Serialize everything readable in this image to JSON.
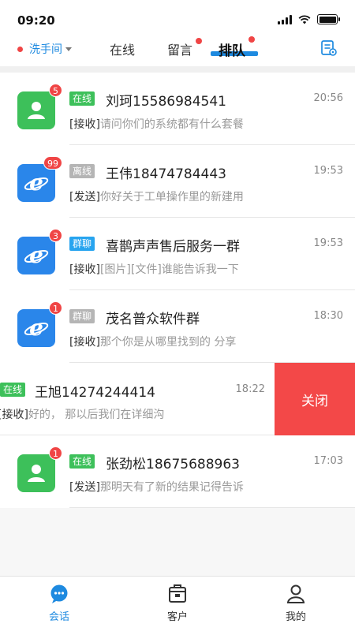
{
  "status": {
    "time": "09:20"
  },
  "top": {
    "group_label": "洗手间",
    "tabs": [
      {
        "label": "在线"
      },
      {
        "label": "留言"
      },
      {
        "label": "排队"
      }
    ]
  },
  "conversations": [
    {
      "tag": "在线",
      "name": "刘珂15586984541",
      "time": "20:56",
      "prefix": "[接收]",
      "message": "请问你们的系统都有什么套餐",
      "badge": "5"
    },
    {
      "tag": "离线",
      "name": "王伟18474784443",
      "time": "19:53",
      "prefix": "[发送]",
      "message": "你好关于工单操作里的新建用",
      "badge": "99"
    },
    {
      "tag": "群聊",
      "name": "喜鹊声声售后服务一群",
      "time": "19:53",
      "prefix": "[接收]",
      "message": "[图片][文件]谁能告诉我一下",
      "badge": "3"
    },
    {
      "tag": "群聊",
      "name": "茂名普众软件群",
      "time": "18:30",
      "prefix": "[接收]",
      "message": "那个你是从哪里找到的 分享",
      "badge": "1"
    },
    {
      "tag": "在线",
      "name": "王旭14274244414",
      "time": "18:22",
      "prefix": "[接收]",
      "message": "好的， 那以后我们在详细沟",
      "action": "关闭"
    },
    {
      "tag": "在线",
      "name": "张劲松18675688963",
      "time": "17:03",
      "prefix": "[发送]",
      "message": "那明天有了新的结果记得告诉",
      "badge": "1"
    }
  ],
  "nav": [
    {
      "label": "会话"
    },
    {
      "label": "客户"
    },
    {
      "label": "我的"
    }
  ],
  "colors": {
    "accent": "#1e8ae0",
    "online": "#3dc05a",
    "badge": "#f04545",
    "close": "#f34848"
  }
}
